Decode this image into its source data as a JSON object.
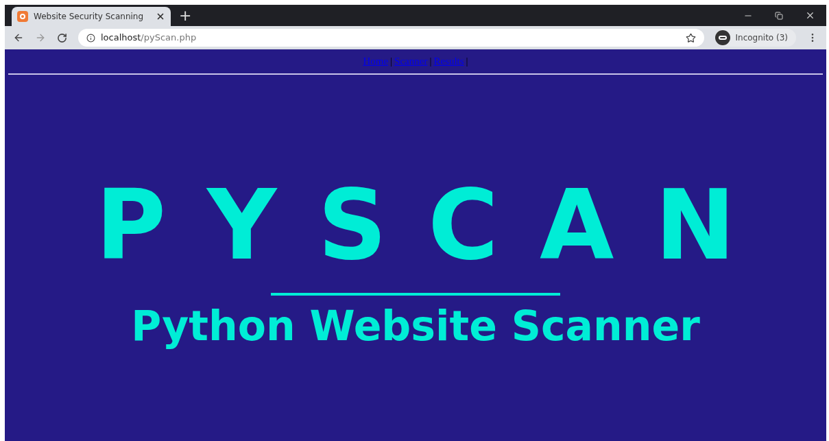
{
  "browser": {
    "tabs": [
      {
        "title": "Website Security Scanning",
        "selected": true
      }
    ],
    "new_tab": "+",
    "address": {
      "host": "localhost",
      "path": "/pyScan.php"
    },
    "profile": "Incognito (3)"
  },
  "nav": {
    "separator": "|",
    "links": [
      "Home",
      "Scanner",
      "Results"
    ]
  },
  "hero": {
    "logo": "PYSCAN",
    "subtitle": "Python Website Scanner"
  }
}
